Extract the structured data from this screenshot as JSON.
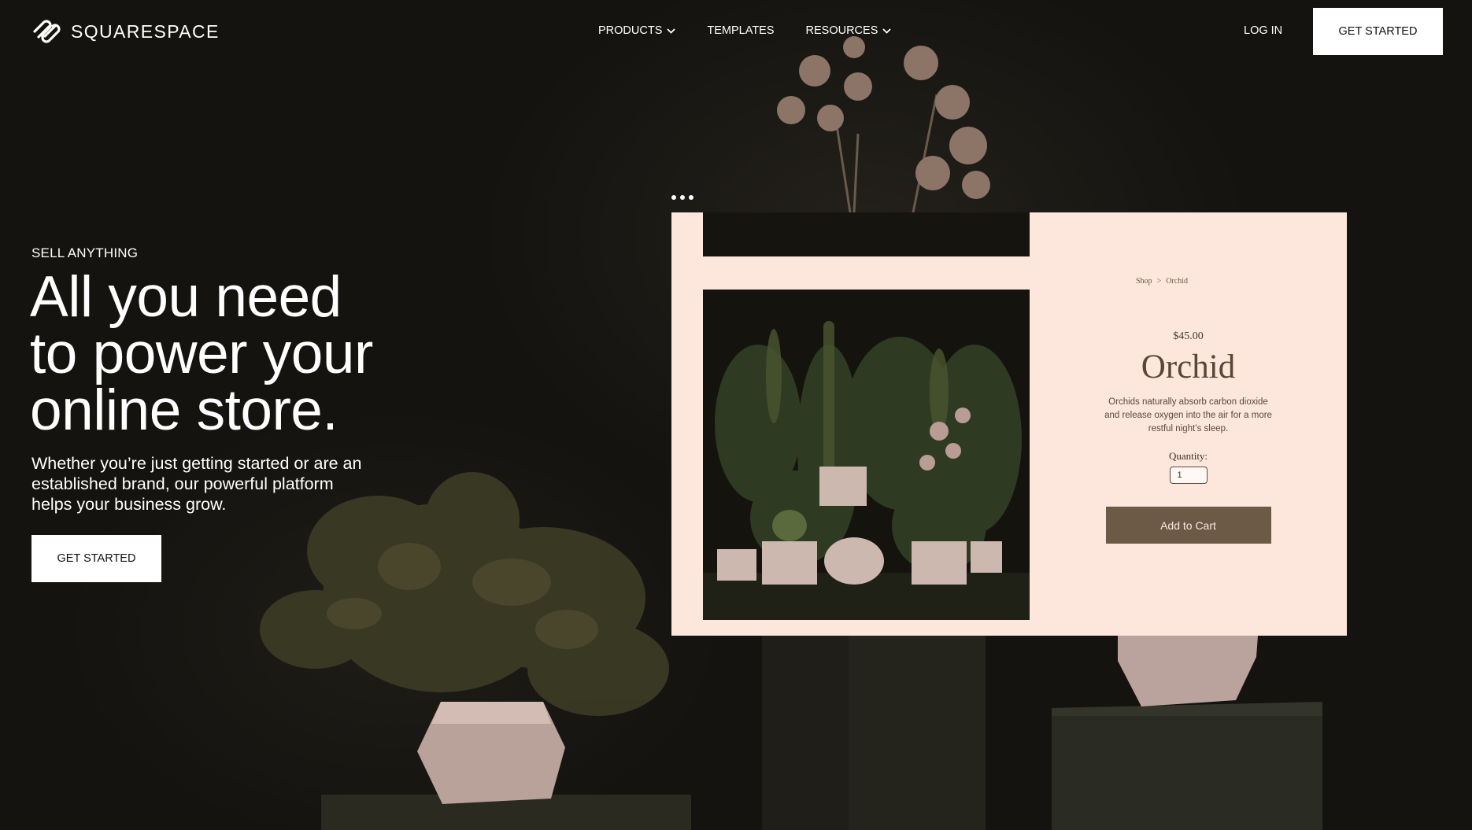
{
  "brand": {
    "name": "SQUARESPACE"
  },
  "nav": {
    "items": [
      {
        "label": "PRODUCTS",
        "has_dropdown": true
      },
      {
        "label": "TEMPLATES",
        "has_dropdown": false
      },
      {
        "label": "RESOURCES",
        "has_dropdown": true
      }
    ],
    "login": "LOG IN",
    "cta": "GET STARTED"
  },
  "hero": {
    "eyebrow": "SELL ANYTHING",
    "headline_lines": [
      "All you need",
      "to power your",
      "online store."
    ],
    "subtext_lines": [
      "Whether you’re just getting started or are an",
      "established brand, our powerful platform",
      "helps your business grow."
    ],
    "cta": "GET STARTED"
  },
  "mock_store": {
    "breadcrumb": {
      "shop": "Shop",
      "separator": ">",
      "current": "Orchid"
    },
    "price": "$45.00",
    "title": "Orchid",
    "description_lines": [
      "Orchids naturally absorb carbon dioxide",
      "and release oxygen into the air for a more",
      "restful night’s sleep."
    ],
    "quantity_label": "Quantity:",
    "quantity_value": "1",
    "add_to_cart": "Add to Cart"
  },
  "colors": {
    "background": "#141310",
    "mock_background": "#fde6dc",
    "button_brown": "#6d5a46",
    "title_brown": "#5a4635"
  }
}
